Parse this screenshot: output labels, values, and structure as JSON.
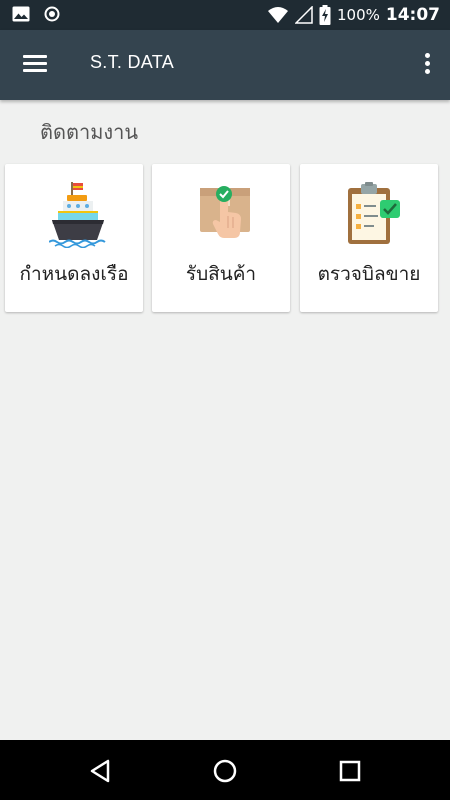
{
  "status_bar": {
    "left_icons": [
      "image-icon",
      "circle-dot-icon"
    ],
    "right_icons": [
      "wifi-icon",
      "signal-icon",
      "battery-icon"
    ],
    "battery": "100%",
    "time": "14:07"
  },
  "app_bar": {
    "title": "S.T. DATA",
    "menu_icon": "hamburger-menu-icon",
    "overflow_icon": "more-vertical-icon",
    "background": "#34444f"
  },
  "section": {
    "title": "ติดตามงาน"
  },
  "cards": [
    {
      "label": "กำหนดลงเรือ",
      "icon": "ship-icon"
    },
    {
      "label": "รับสินค้า",
      "icon": "package-receive-icon"
    },
    {
      "label": "ตรวจบิลขาย",
      "icon": "clipboard-check-icon"
    }
  ],
  "nav_bar": {
    "back_icon": "back-triangle-icon",
    "home_icon": "home-circle-icon",
    "recents_icon": "recents-square-icon"
  }
}
